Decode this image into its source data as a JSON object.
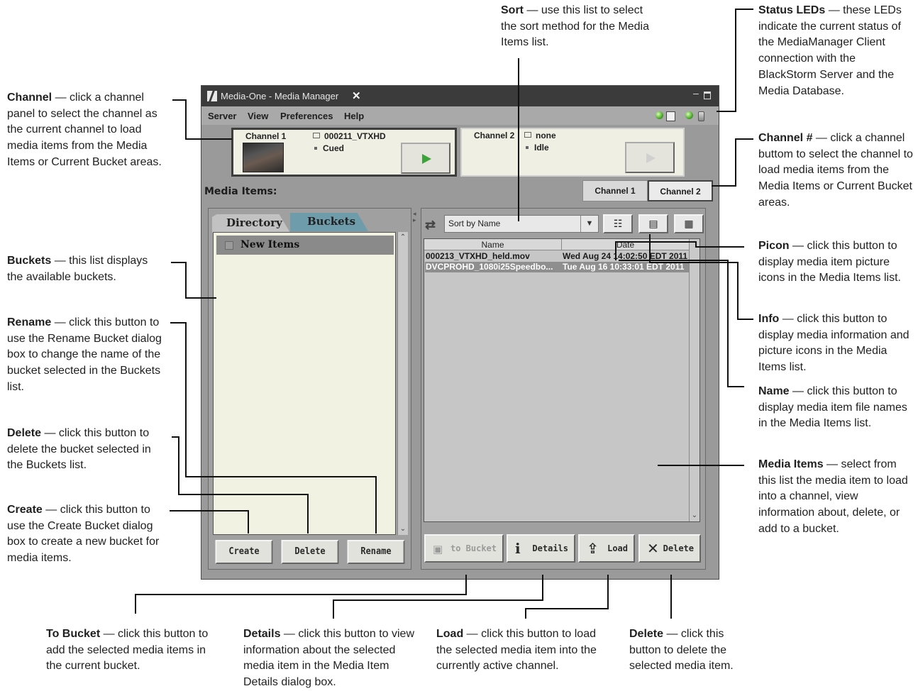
{
  "app": {
    "title": "Media-One - Media Manager",
    "close_glyph": "✕",
    "menu": [
      "Server",
      "View",
      "Preferences",
      "Help"
    ],
    "status_led_colors": [
      "#4aa82a",
      "#4aa82a"
    ],
    "channels": [
      {
        "name": "Channel 1",
        "clip": "000211_VTXHD",
        "state": "Cued",
        "active": true
      },
      {
        "name": "Channel 2",
        "clip": "none",
        "state": "Idle",
        "active": false
      }
    ],
    "media_items_label": "Media Items:",
    "channel_tabs": [
      "Channel 1",
      "Channel 2"
    ],
    "left_tabs": {
      "directory": "Directory",
      "buckets": "Buckets"
    },
    "buckets": [
      "New Items"
    ],
    "bucket_buttons": {
      "create": "Create",
      "delete": "Delete",
      "rename": "Rename"
    },
    "sort": {
      "selected": "Sort by Name"
    },
    "view_icons": [
      "name-view-icon",
      "info-view-icon",
      "picon-view-icon"
    ],
    "columns": [
      "Name",
      "Date"
    ],
    "media_items": [
      {
        "name": "000213_VTXHD_held.mov",
        "date": "Wed Aug 24 14:02:50 EDT 2011",
        "selected": false
      },
      {
        "name": "DVCPROHD_1080i25Speedbo...",
        "date": "Tue Aug 16 10:33:01 EDT 2011",
        "selected": true
      }
    ],
    "action_buttons": {
      "to_bucket": "to Bucket",
      "details": "Details",
      "load": "Load",
      "delete": "Delete"
    }
  },
  "callouts": {
    "sort": {
      "term": "Sort",
      "text": "— use this list to select the sort method for the Media Items list."
    },
    "status_leds": {
      "term": "Status LEDs",
      "text": "— these LEDs indicate the current status of the MediaManager Client connection with the BlackStorm Server and the Media Database."
    },
    "channel": {
      "term": "Channel",
      "text": "— click a channel panel to select the channel as the current channel to load media items from the Media Items or Current Bucket areas."
    },
    "channel_num": {
      "term": "Channel #",
      "text": "— click a channel buttom to select the channel to load media items from the Media Items or Current Bucket areas."
    },
    "buckets": {
      "term": "Buckets",
      "text": "— this list displays the available buckets."
    },
    "picon": {
      "term": "Picon",
      "text": "— click this button to display media item picture icons in the Media Items list."
    },
    "rename": {
      "term": "Rename",
      "text": "— click this button to use the Rename Bucket dialog box to change the name of the bucket selected in the Buckets list."
    },
    "info": {
      "term": "Info",
      "text": "— click this button to display media information and picture icons in the Media Items list."
    },
    "name": {
      "term": "Name",
      "text": "— click this button to display media item file names in the Media Items list."
    },
    "delete_bucket": {
      "term": "Delete",
      "text": "— click this button to delete the bucket selected in the Buckets list."
    },
    "media_items": {
      "term": "Media Items",
      "text": "— select from this list the media item to load into a channel, view information about, delete, or add to a bucket."
    },
    "create": {
      "term": "Create",
      "text": "— click this button to use the Create Bucket dialog box to create a new bucket for media items."
    },
    "to_bucket": {
      "term": "To Bucket",
      "text": "— click this button to add the selected media items in the current bucket."
    },
    "details": {
      "term": "Details",
      "text": "— click this button to view information about the selected media item in the Media Item Details dialog box."
    },
    "load": {
      "term": "Load",
      "text": "— click this button to load the selected media item into the currently active channel."
    },
    "delete_item": {
      "term": "Delete",
      "text": "— click this button to delete the selected media item."
    }
  }
}
